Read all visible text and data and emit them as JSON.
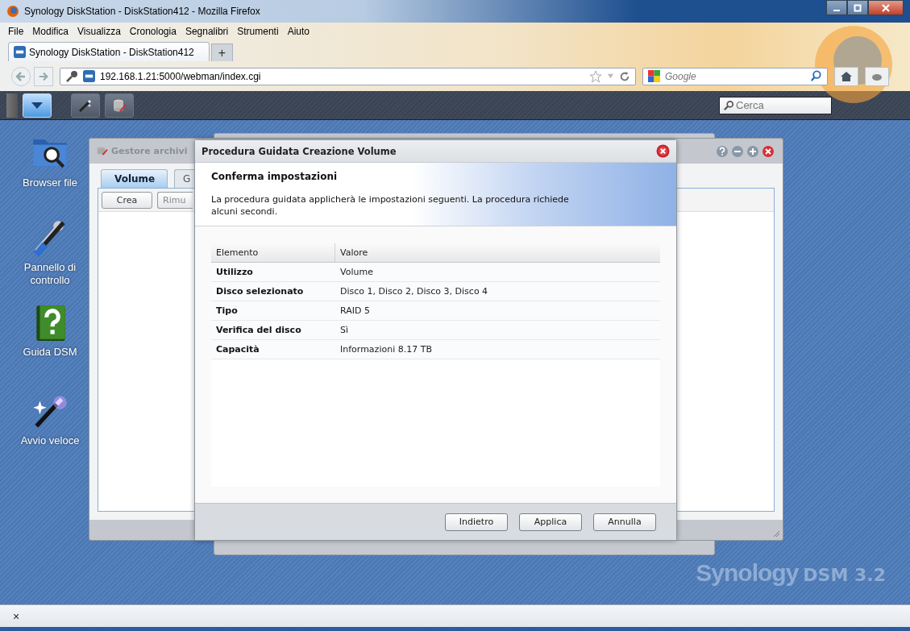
{
  "browser": {
    "title": "Synology DiskStation - DiskStation412 - Mozilla Firefox",
    "menu": [
      {
        "label": "File"
      },
      {
        "label": "Modifica"
      },
      {
        "label": "Visualizza"
      },
      {
        "label": "Cronologia"
      },
      {
        "label": "Segnalibri"
      },
      {
        "label": "Strumenti"
      },
      {
        "label": "Aiuto"
      }
    ],
    "tab": {
      "title": "Synology DiskStation - DiskStation412",
      "new_tab": "+"
    },
    "url": "192.168.1.21:5000/webman/index.cgi",
    "search": {
      "placeholder": "Google"
    }
  },
  "dsm_taskbar": {
    "search": {
      "placeholder": "Cerca"
    }
  },
  "desktop_icons": [
    {
      "label": "Browser file",
      "kind": "folder"
    },
    {
      "label": "Pannello di controllo",
      "kind": "tools"
    },
    {
      "label": "Guida DSM",
      "kind": "help"
    },
    {
      "label": "Avvio veloce",
      "kind": "wand"
    }
  ],
  "storage_window": {
    "title": "Gestore archivi",
    "tabs": [
      {
        "label": "Volume",
        "selected": true
      },
      {
        "label": "G",
        "selected": false
      }
    ],
    "buttons": [
      "Crea",
      "Rimu"
    ]
  },
  "dialog": {
    "title": "Procedura Guidata Creazione Volume",
    "heading": "Conferma impostazioni",
    "description": "La procedura guidata applicherà le impostazioni seguenti. La procedura richiede alcuni secondi.",
    "table": {
      "columns": [
        "Elemento",
        "Valore"
      ],
      "rows": [
        {
          "item": "Utilizzo",
          "value": "Volume"
        },
        {
          "item": "Disco selezionato",
          "value": "Disco 1, Disco 2, Disco 3, Disco 4"
        },
        {
          "item": "Tipo",
          "value": "RAID 5"
        },
        {
          "item": "Verifica del disco",
          "value": "Sì"
        },
        {
          "item": "Capacità",
          "value": "Informazioni 8.17 TB"
        }
      ]
    },
    "buttons": [
      "Indietro",
      "Applica",
      "Annulla"
    ]
  },
  "branding": {
    "logo": "Synology",
    "product": "DSM 3.2"
  },
  "status_bar": {
    "close": "×"
  }
}
